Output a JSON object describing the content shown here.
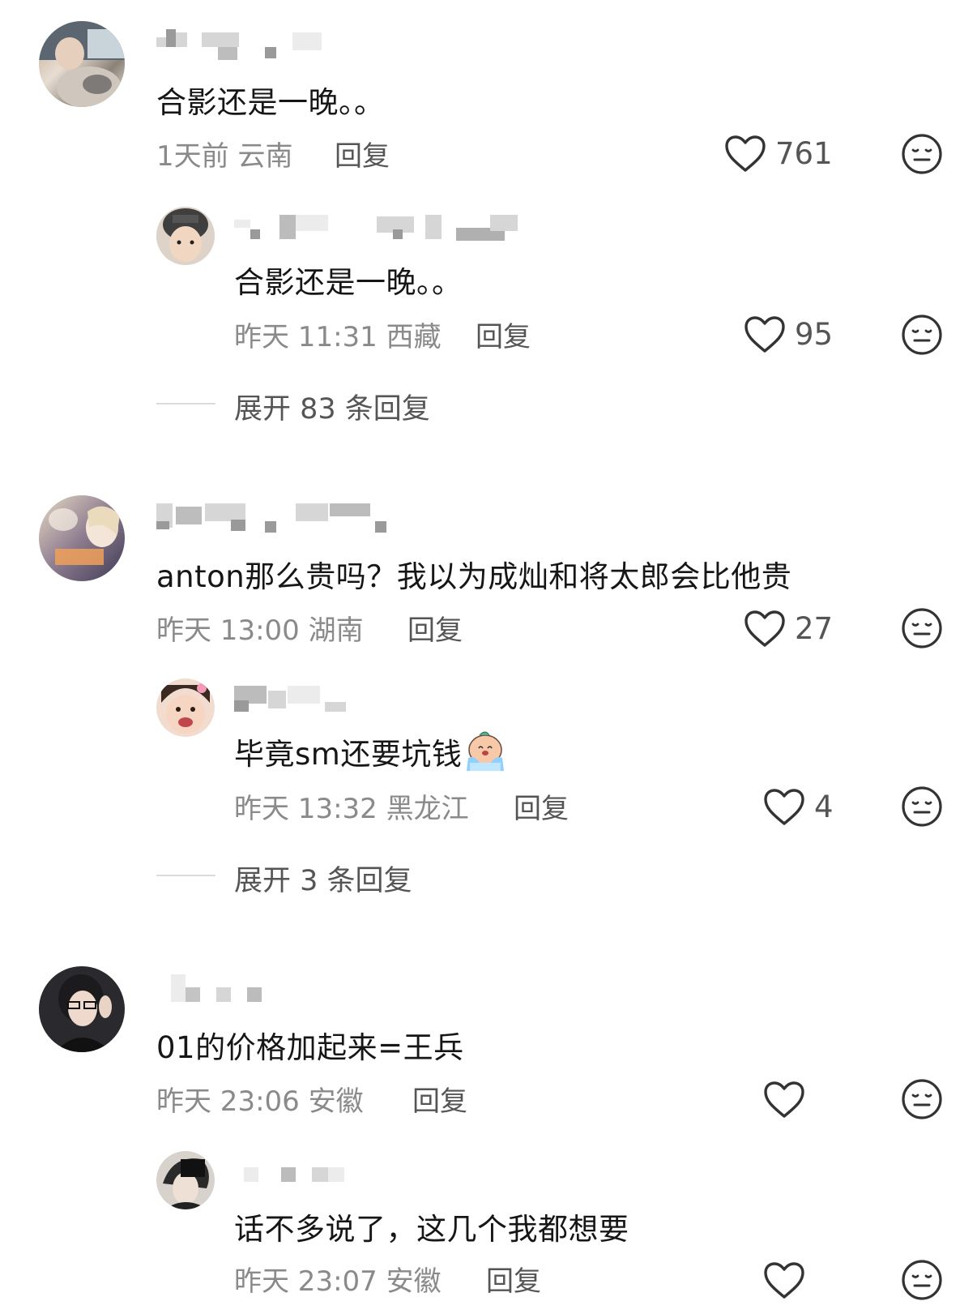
{
  "comments": [
    {
      "text": "合影还是一晚。。",
      "meta": "1天前 云南",
      "reply": "回复",
      "likes": "761",
      "sub": {
        "text": "合影还是一晚。。",
        "meta": "昨天 11:31 西藏",
        "reply": "回复",
        "likes": "95"
      },
      "expand": "展开 83 条回复"
    },
    {
      "text": "anton那么贵吗？我以为成灿和将太郎会比他贵",
      "meta": "昨天 13:00 湖南",
      "reply": "回复",
      "likes": "27",
      "sub": {
        "text": "毕竟sm还要坑钱",
        "meta": "昨天 13:32 黑龙江",
        "reply": "回复",
        "likes": "4"
      },
      "expand": "展开 3 条回复"
    },
    {
      "text": "01的价格加起来=王兵",
      "meta": "昨天 23:06 安徽",
      "reply": "回复",
      "likes": "",
      "sub": {
        "text": "话不多说了，这几个我都想要",
        "meta": "昨天 23:07 安徽",
        "reply": "回复",
        "likes": ""
      }
    }
  ],
  "icons": {
    "like": "heart-outline-icon",
    "dislike": "neutral-face-icon",
    "emoji": "crying-emoji-icon"
  },
  "colors": {
    "text": "#161616",
    "meta": "#8a8a8a",
    "reply": "#555555",
    "icon": "#333333"
  }
}
